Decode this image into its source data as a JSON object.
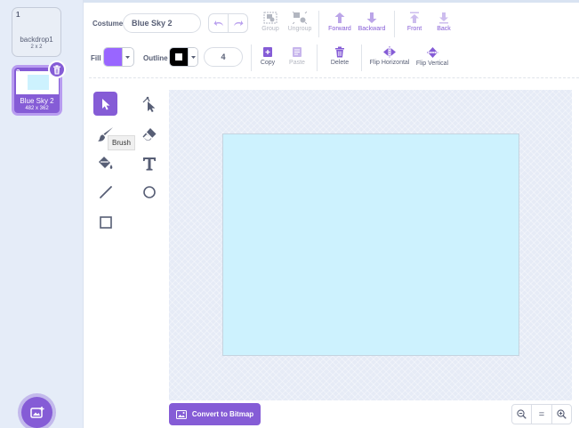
{
  "costumes": [
    {
      "number": "1",
      "name": "backdrop1",
      "size": "2 x 2"
    },
    {
      "number": "2",
      "name": "Blue Sky 2",
      "size": "482 x 362"
    }
  ],
  "toolbar": {
    "costume_label": "Costume",
    "costume_name": "Blue Sky 2",
    "group": "Group",
    "ungroup": "Ungroup",
    "forward": "Forward",
    "backward": "Backward",
    "front": "Front",
    "back": "Back",
    "fill_label": "Fill",
    "outline_label": "Outline",
    "outline_width": "4",
    "copy": "Copy",
    "paste": "Paste",
    "delete": "Delete",
    "flip_horizontal": "Flip Horizontal",
    "flip_vertical": "Flip Vertical"
  },
  "colors": {
    "fill": "#9966ff",
    "outline": "#000000",
    "accent": "#855cd6",
    "canvas_art": "#cdf2fe"
  },
  "tooltip": "Brush",
  "convert_button": "Convert to Bitmap",
  "zoom": {
    "out": "−",
    "reset": "=",
    "in": "+"
  }
}
